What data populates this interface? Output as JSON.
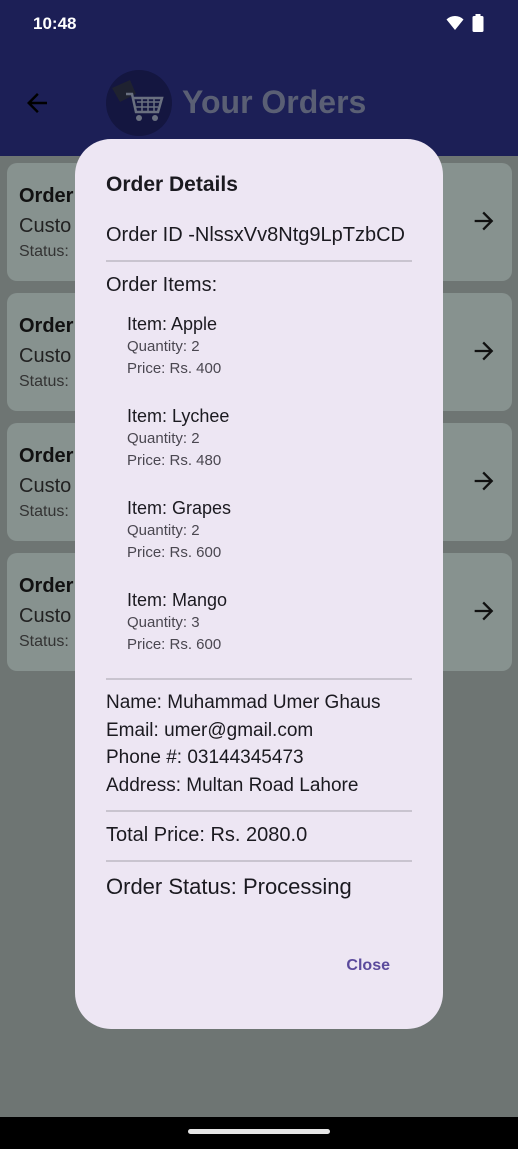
{
  "status_bar": {
    "time": "10:48"
  },
  "app_bar": {
    "title": "Your Orders"
  },
  "order_cards": [
    {
      "line1": "Order",
      "line2": "Custo",
      "line3": "Status:"
    },
    {
      "line1": "Order",
      "line2": "Custo",
      "line3": "Status:"
    },
    {
      "line1": "Order",
      "line2": "Custo",
      "line3": "Status:"
    },
    {
      "line1": "Order",
      "line2": "Custo",
      "line3": "Status:"
    }
  ],
  "dialog": {
    "title": "Order Details",
    "order_id": "Order ID -NlssxVv8Ntg9LpTzbCD",
    "items_heading": "Order Items:",
    "items": [
      {
        "item": "Item: Apple",
        "quantity": "Quantity: 2",
        "price": "Price: Rs. 400"
      },
      {
        "item": "Item: Lychee",
        "quantity": "Quantity: 2",
        "price": "Price: Rs. 480"
      },
      {
        "item": "Item: Grapes",
        "quantity": "Quantity: 2",
        "price": "Price: Rs. 600"
      },
      {
        "item": "Item: Mango",
        "quantity": "Quantity: 3",
        "price": "Price: Rs. 600"
      }
    ],
    "customer": {
      "name": "Name: Muhammad Umer Ghaus",
      "email": "Email: umer@gmail.com",
      "phone": "Phone #: 03144345473",
      "address": "Address: Multan Road Lahore"
    },
    "total_price": "Total Price: Rs. 2080.0",
    "order_status": "Order Status: Processing",
    "close_label": "Close"
  },
  "icons": {
    "status": [
      "wifi-icon",
      "battery-icon"
    ],
    "back": "arrow-left-icon",
    "logo": "shopping-cart-icon",
    "card_arrow": "arrow-right-icon"
  },
  "colors": {
    "app_bar": "#1c1f56",
    "dialog_bg": "#ede6f3",
    "accent": "#5b4a9c",
    "scrim": "#6e7573"
  }
}
